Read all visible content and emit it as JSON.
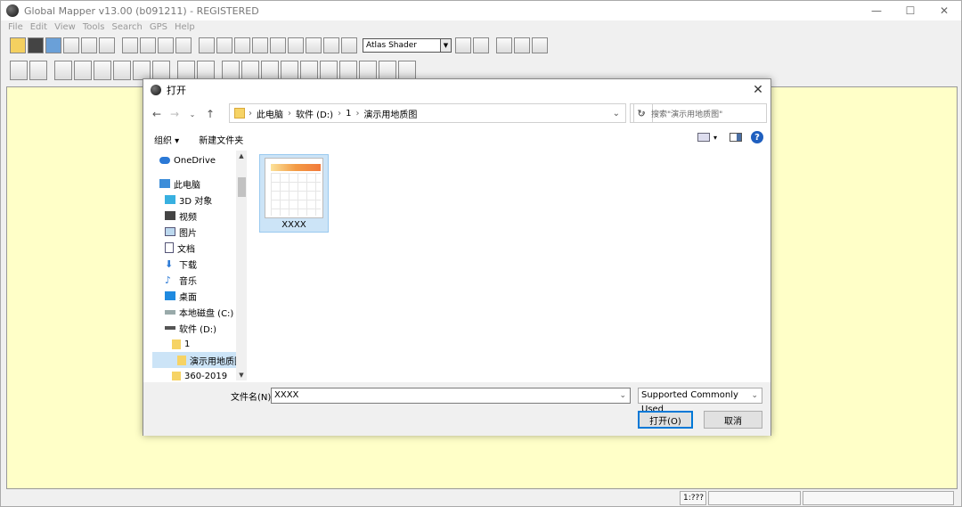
{
  "app": {
    "title": "Global Mapper v13.00 (b091211) - REGISTERED",
    "menu": [
      "File",
      "Edit",
      "View",
      "Tools",
      "Search",
      "GPS",
      "Help"
    ],
    "shader": "Atlas Shader",
    "window_controls": {
      "minimize": "—",
      "maximize": "☐",
      "close": "✕"
    },
    "map_background": "#ffffc8",
    "status": {
      "scale": "1:???"
    }
  },
  "dialog": {
    "title": "打开",
    "close": "✕",
    "breadcrumb": [
      "此电脑",
      "软件 (D:)",
      "1",
      "演示用地质图"
    ],
    "search_placeholder": "搜索\"演示用地质图\"",
    "commands": {
      "organize": "组织 ▾",
      "new_folder": "新建文件夹"
    },
    "nav": [
      {
        "label": "OneDrive",
        "icon": "cloud-icon"
      },
      {
        "label": "此电脑",
        "icon": "computer-icon"
      },
      {
        "label": "3D 对象",
        "icon": "cube-icon"
      },
      {
        "label": "视频",
        "icon": "video-icon"
      },
      {
        "label": "图片",
        "icon": "picture-icon"
      },
      {
        "label": "文档",
        "icon": "document-icon"
      },
      {
        "label": "下载",
        "icon": "download-icon"
      },
      {
        "label": "音乐",
        "icon": "music-icon"
      },
      {
        "label": "桌面",
        "icon": "desktop-icon"
      },
      {
        "label": "本地磁盘 (C:)",
        "icon": "drive-icon"
      },
      {
        "label": "软件 (D:)",
        "icon": "drive-icon"
      },
      {
        "label": "1",
        "icon": "folder-icon"
      },
      {
        "label": "演示用地质图",
        "icon": "folder-icon"
      },
      {
        "label": "360-2019",
        "icon": "folder-icon"
      }
    ],
    "files": [
      {
        "name": "XXXX"
      }
    ],
    "filename_label": "文件名(N):",
    "filename_value": "XXXX",
    "filetype": "Supported Commonly Used",
    "open_button": "打开(O)",
    "cancel_button": "取消"
  }
}
